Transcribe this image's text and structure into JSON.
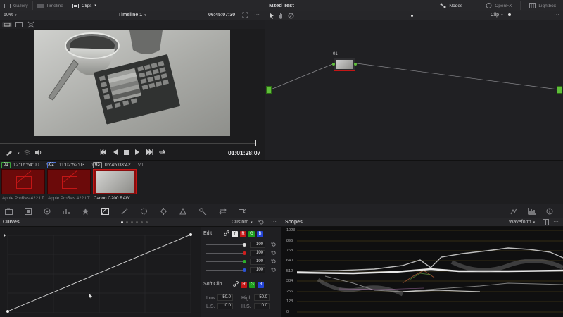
{
  "topbar": {
    "gallery": "Gallery",
    "timeline": "Timeline",
    "clips": "Clips",
    "project_title": "Mzed Test",
    "nodes": "Nodes",
    "openfx": "OpenFX",
    "lightbox": "Lightbox"
  },
  "viewer": {
    "zoom": "60%",
    "timeline_name": "Timeline 1",
    "timecode_top": "06:45:07:30",
    "timecode": "01:01:28:07"
  },
  "node_editor": {
    "mode": "Clip",
    "node_label": "01"
  },
  "clips": [
    {
      "num": "01",
      "tc": "12:16:54:00",
      "track": "V1",
      "name": "Apple ProRes 422 LT",
      "num_color": "#3ca43c"
    },
    {
      "num": "02",
      "tc": "11:02:52:03",
      "track": "V1",
      "name": "Apple ProRes 422 LT",
      "num_color": "#4a6fd0"
    },
    {
      "num": "03",
      "tc": "06:45:03:42",
      "track": "V1",
      "name": "Canon C200 RAW",
      "num_color": "#9a9a9a"
    }
  ],
  "curves": {
    "title": "Curves",
    "preset": "Custom",
    "edit_label": "Edit",
    "channels": [
      "Y",
      "R",
      "G",
      "B"
    ],
    "rows": [
      {
        "color": "#dddddd",
        "value": "100"
      },
      {
        "color": "#d21e1e",
        "value": "100"
      },
      {
        "color": "#2bb02b",
        "value": "100"
      },
      {
        "color": "#2a52d8",
        "value": "100"
      }
    ],
    "soft_clip": "Soft Clip",
    "low_label": "Low",
    "low_value": "50.0",
    "high_label": "High",
    "high_value": "50.0",
    "ls_label": "L.S.",
    "ls_value": "0.0",
    "hs_label": "H.S.",
    "hs_value": "0.0"
  },
  "scopes": {
    "title": "Scopes",
    "mode": "Waveform",
    "scale": [
      "1023",
      "896",
      "768",
      "640",
      "512",
      "384",
      "256",
      "128",
      "0"
    ]
  },
  "colors": {
    "accent_red": "#c41616",
    "node_green": "#5fbf3a"
  }
}
